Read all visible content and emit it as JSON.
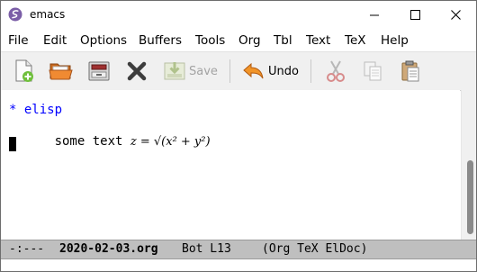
{
  "window": {
    "title": "emacs",
    "accent": "#7b5ea7"
  },
  "menubar": {
    "items": [
      "File",
      "Edit",
      "Options",
      "Buffers",
      "Tools",
      "Org",
      "Tbl",
      "Text",
      "TeX",
      "Help"
    ]
  },
  "toolbar": {
    "save_label": "Save",
    "undo_label": "Undo",
    "icons": [
      "new-file-icon",
      "open-folder-icon",
      "dired-icon",
      "close-x-icon",
      "save-icon",
      "undo-icon",
      "cut-icon",
      "copy-icon",
      "paste-icon"
    ]
  },
  "editor": {
    "line1": "* elisp",
    "line2_text": "some text ",
    "line2_math": "z = √(x² + y²)",
    "heading_color": "#0000ff"
  },
  "modeline": {
    "status": "-:---",
    "buffer": "2020-02-03.org",
    "position": "Bot L13",
    "modes": "(Org TeX ElDoc)"
  }
}
